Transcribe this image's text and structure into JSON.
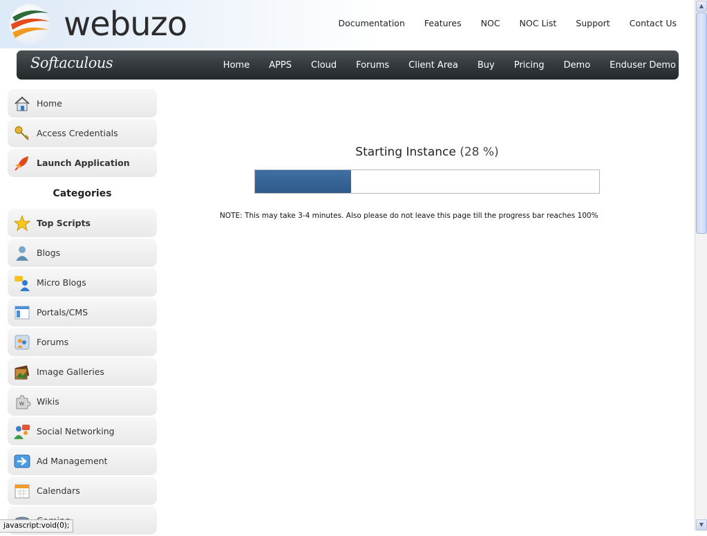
{
  "brand": {
    "name": "webuzo",
    "sub_logo": "Softaculous"
  },
  "top_links": [
    "Documentation",
    "Features",
    "NOC",
    "NOC List",
    "Support",
    "Contact Us"
  ],
  "nav_links": [
    "Home",
    "APPS",
    "Cloud",
    "Forums",
    "Client Area",
    "Buy",
    "Pricing",
    "Demo",
    "Enduser Demo"
  ],
  "sidebar": {
    "top_items": [
      {
        "label": "Home",
        "icon": "home-icon"
      },
      {
        "label": "Access Credentials",
        "icon": "keys-icon"
      },
      {
        "label": "Launch Application",
        "icon": "rocket-icon"
      }
    ],
    "categories_title": "Categories",
    "categories": [
      {
        "label": "Top Scripts",
        "icon": "star-icon"
      },
      {
        "label": "Blogs",
        "icon": "user-icon"
      },
      {
        "label": "Micro Blogs",
        "icon": "chat-user-icon"
      },
      {
        "label": "Portals/CMS",
        "icon": "window-icon"
      },
      {
        "label": "Forums",
        "icon": "forum-icon"
      },
      {
        "label": "Image Galleries",
        "icon": "gallery-icon"
      },
      {
        "label": "Wikis",
        "icon": "puzzle-icon"
      },
      {
        "label": "Social Networking",
        "icon": "social-icon"
      },
      {
        "label": "Ad Management",
        "icon": "ad-arrow-icon"
      },
      {
        "label": "Calendars",
        "icon": "calendar-icon"
      },
      {
        "label": "Gaming",
        "icon": "gamepad-icon"
      }
    ]
  },
  "main": {
    "title": "Starting Instance",
    "percent_text": "(28 %)",
    "progress": 0.28,
    "note": "NOTE: This may take 3-4 minutes. Also please do not leave this page till the progress bar reaches 100%"
  },
  "status_bar": "javascript:void(0);",
  "colors": {
    "progress_fill": "#2e5a8a",
    "navbar": "#343a3e",
    "accent_logo": "#e04a1e"
  }
}
